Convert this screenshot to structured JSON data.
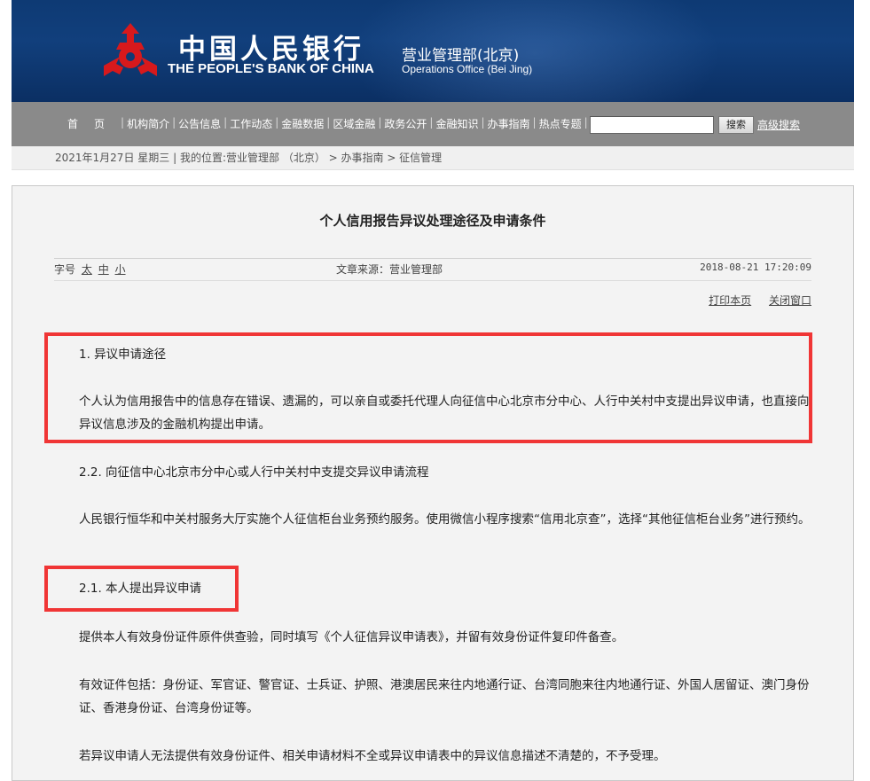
{
  "header": {
    "brand_cn": "中国人民银行",
    "brand_en": "THE PEOPLE'S BANK OF CHINA",
    "office_cn": "营业管理部(北京)",
    "office_en": "Operations Office (Bei Jing)",
    "colors": {
      "header_bg": "#0e3a74",
      "logo_red": "#d7191c"
    }
  },
  "nav": {
    "items": [
      "首页",
      "机构简介",
      "公告信息",
      "工作动态",
      "金融数据",
      "区域金融",
      "政务公开",
      "金融知识",
      "办事指南",
      "热点专题"
    ],
    "search_placeholder": "",
    "search_button": "搜索",
    "advanced_search": "高级搜索"
  },
  "breadcrumb": {
    "date": "2021年1月27日 星期三",
    "location_label": "我的位置:",
    "path": "营业管理部 （北京） > 办事指南 > 征信管理"
  },
  "article": {
    "title": "个人信用报告异议处理途径及申请条件",
    "font_size_label": "字号",
    "font_sizes": [
      "太",
      "中",
      "小"
    ],
    "source": "文章来源：营业管理部",
    "datetime": "2018-08-21 17:20:09",
    "print": "打印本页",
    "close": "关闭窗口",
    "paragraphs": [
      "1. 异议申请途径",
      "个人认为信用报告中的信息存在错误、遗漏的，可以亲自或委托代理人向征信中心北京市分中心、人行中关村中支提出异议申请，也直接向异议信息涉及的金融机构提出申请。",
      "2.2. 向征信中心北京市分中心或人行中关村中支提交异议申请流程",
      "人民银行恒华和中关村服务大厅实施个人征信柜台业务预约服务。使用微信小程序搜索“信用北京查”，选择“其他征信柜台业务”进行预约。",
      "2.1. 本人提出异议申请",
      "提供本人有效身份证件原件供查验，同时填写《个人征信异议申请表》，并留有效身份证件复印件备查。",
      "有效证件包括：身份证、军官证、警官证、士兵证、护照、港澳居民来往内地通行证、台湾同胞来往内地通行证、外国人居留证、澳门身份证、香港身份证、台湾身份证等。",
      "若异议申请人无法提供有效身份证件、相关申请材料不全或异议申请表中的异议信息描述不清楚的，不予受理。"
    ]
  },
  "annotation_color": "#f03535"
}
